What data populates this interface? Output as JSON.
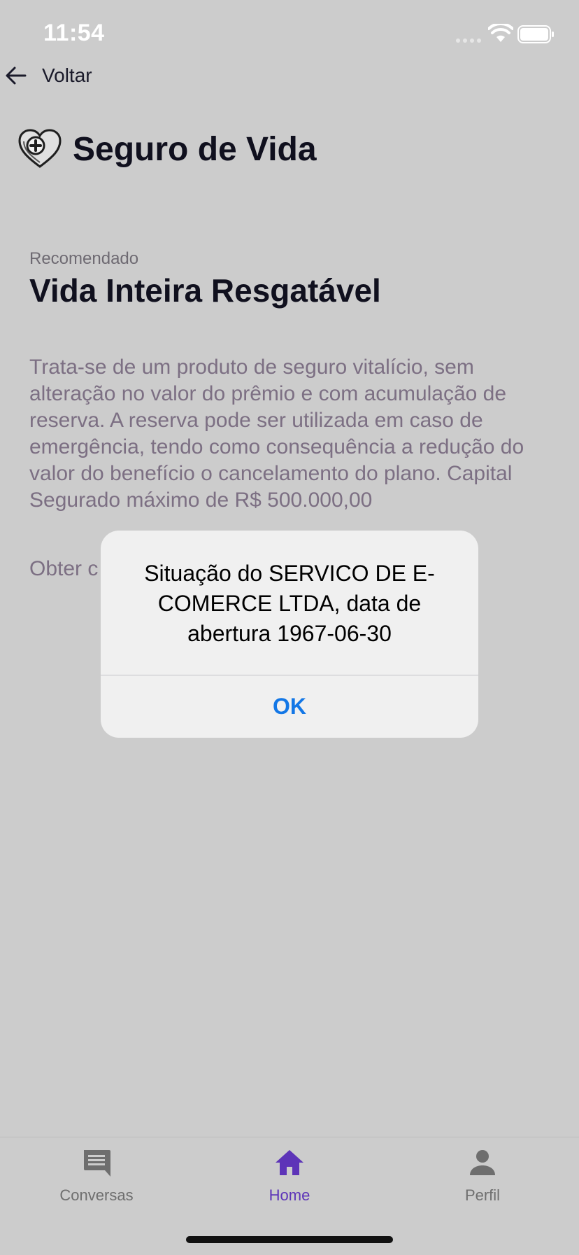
{
  "status_bar": {
    "time": "11:54"
  },
  "nav": {
    "back_label": "Voltar"
  },
  "header": {
    "title": "Seguro de Vida",
    "icon": "heart-plus-icon"
  },
  "product": {
    "recommended_label": "Recomendado",
    "title": "Vida Inteira Resgatável",
    "description": "Trata-se de um produto de seguro vitalício, sem alteração no valor do prêmio e com acumulação de reserva. A reserva pode ser utilizada em caso de emergência, tendo como consequência a redução do valor do benefício o cancelamento do plano. Capital Segurado máximo de R$ 500.000,00",
    "obter_link_visible": "Obter c"
  },
  "alert": {
    "message": "Situação do SERVICO DE E-COMERCE LTDA, data de abertura 1967-06-30",
    "ok_label": "OK",
    "ok_color": "#1377e6"
  },
  "tab_bar": {
    "active_color": "#5d34b8",
    "items": [
      {
        "label": "Conversas",
        "icon": "chat-icon",
        "active": false
      },
      {
        "label": "Home",
        "icon": "home-icon",
        "active": true
      },
      {
        "label": "Perfil",
        "icon": "person-icon",
        "active": false
      }
    ]
  }
}
